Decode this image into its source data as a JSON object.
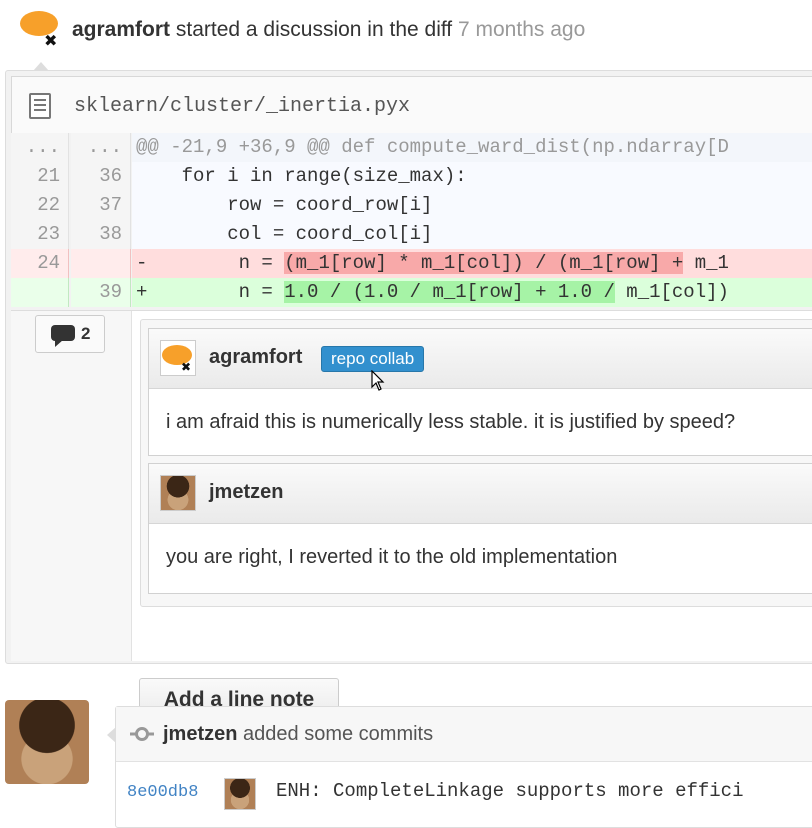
{
  "discussion": {
    "author": "agramfort",
    "action": "started a discussion in the diff",
    "time": "7 months ago"
  },
  "file": {
    "path": "sklearn/cluster/_inertia.pyx"
  },
  "diff": {
    "hunk": {
      "old": "...",
      "new": "...",
      "code": "@@ -21,9 +36,9 @@ def compute_ward_dist(np.ndarray[D"
    },
    "lines": [
      {
        "old": "21",
        "new": "36",
        "code": "    for i in range(size_max):"
      },
      {
        "old": "22",
        "new": "37",
        "code": "        row = coord_row[i]"
      },
      {
        "old": "23",
        "new": "38",
        "code": "        col = coord_col[i]"
      }
    ],
    "deleted": {
      "old": "24",
      "sign": "-",
      "prefix": "        n = ",
      "highlight": "(m_1[row] * m_1[col]) / (m_1[row] +",
      "suffix": " m_1"
    },
    "added": {
      "new": "39",
      "sign": "+",
      "prefix": "        n = ",
      "highlight": "1.0 / (1.0 / m_1[row] + 1.0 /",
      "suffix": " m_1[col])"
    }
  },
  "thread": {
    "comment_count": "2",
    "comments": [
      {
        "author": "agramfort",
        "badge": "repo collab",
        "body": "i am afraid this is numerically less stable. it is justified by speed?"
      },
      {
        "author": "jmetzen",
        "body": "you are right, I reverted it to the old implementation"
      }
    ],
    "add_note_label": "Add a line note"
  },
  "commits": {
    "author": "jmetzen",
    "action": "added some commits",
    "items": [
      {
        "sha": "8e00db8",
        "message": "ENH: CompleteLinkage supports more effici"
      }
    ]
  },
  "colors": {
    "accent": "#3290ce",
    "link": "#4183c4",
    "deleted_bg": "#ffdddd",
    "added_bg": "#dbffdb",
    "avatar_orange": "#f7a02a"
  },
  "icons": {
    "file": "file-text-icon",
    "comment": "speech-bubble-icon",
    "commit": "git-commit-icon"
  }
}
